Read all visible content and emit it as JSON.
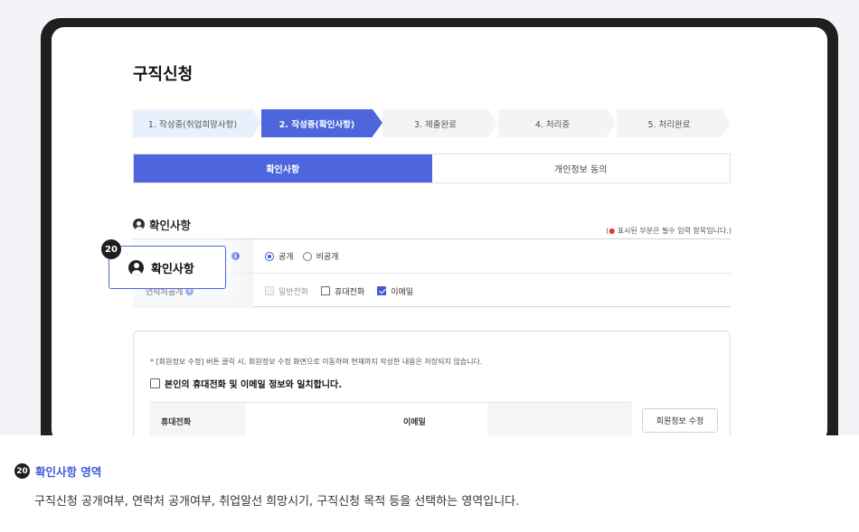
{
  "page": {
    "title": "구직신청"
  },
  "steps": [
    {
      "label": "1. 작성중(취업희망사항)",
      "state": "done"
    },
    {
      "label": "2. 작성중(확인사항)",
      "state": "active"
    },
    {
      "label": "3. 제출완료",
      "state": "todo"
    },
    {
      "label": "4. 처리중",
      "state": "todo"
    },
    {
      "label": "5. 처리완료",
      "state": "todo"
    }
  ],
  "tabs": [
    {
      "label": "확인사항",
      "active": true
    },
    {
      "label": "개인정보 동의",
      "active": false
    }
  ],
  "section": {
    "title": "확인사항",
    "required_prefix": "(",
    "required_dot": "●",
    "required_text": " 표시된 부분은 필수 입력 항목입니다.)"
  },
  "form": {
    "row1": {
      "options": [
        {
          "label": "공개",
          "checked": true
        },
        {
          "label": "비공개",
          "checked": false
        }
      ]
    },
    "row2": {
      "label_visible": "연락처공개",
      "options": [
        {
          "label": "일반전화",
          "checked": false,
          "disabled": true
        },
        {
          "label": "휴대전화",
          "checked": false,
          "disabled": false
        },
        {
          "label": "이메일",
          "checked": true,
          "disabled": false
        }
      ]
    }
  },
  "notice": {
    "text": "* [회원정보 수정] 버튼 클릭 시, 회원정보 수정 화면으로 이동하며 현재까지 작성한 내용은 저장되지 않습니다.",
    "agree_label": "본인의 휴대전화 및 이메일 정보와 일치합니다.",
    "phone_label": "휴대전화",
    "email_label": "이메일",
    "edit_button": "회원정보 수정"
  },
  "callout": {
    "number": "20",
    "label": "확인사항"
  },
  "caption": {
    "number": "20",
    "title": "확인사항 영역",
    "description": "구직신청 공개여부, 연락처 공개여부, 취업알선 희망시기, 구직신청 목적 등을 선택하는 영역입니다."
  },
  "colors": {
    "accent": "#4d66dd",
    "step_done_bg": "#e8f0fb",
    "step_todo_bg": "#f3f4f6"
  }
}
